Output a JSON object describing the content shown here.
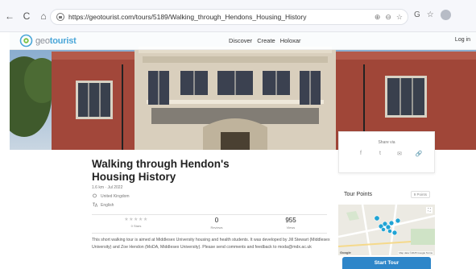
{
  "browser": {
    "url": "https://geotourist.com/tours/5189/Walking_through_Hendons_Housing_History",
    "back": "←",
    "reload": "C",
    "home": "⌂",
    "zoom_icons": [
      "⊕",
      "⊖",
      "☆"
    ],
    "right_icons": [
      "G",
      "☆"
    ]
  },
  "site": {
    "logo_prefix": "geo",
    "logo_suffix": "tourist",
    "nav": [
      "Discover",
      "Create",
      "Holoxar"
    ],
    "login": "Log in"
  },
  "tour": {
    "title": "Walking through Hendon's Housing History",
    "distance_date": "1.6 km · Jul 2022",
    "location": "United Kingdom",
    "language": "English",
    "rating_stars": "★★★★★",
    "rating_label": "0 Stars",
    "reviews_count": "0",
    "reviews_label": "Reviews",
    "views_count": "955",
    "views_label": "Views",
    "description": "This short walking tour is aimed at Middlesex University housing and health students. It was developed by Jill Stewart (Middlesex University) and Zoe Hendon (MoDA, Middlesex University). Please send comments and feedback to moda@mdx.ac.uk"
  },
  "share": {
    "title": "Share via",
    "icons": [
      "f",
      "t",
      "✉",
      "🔗"
    ]
  },
  "tour_points": {
    "title": "Tour Points",
    "badge": "9 Points",
    "button": "Start Tour",
    "google": "Google",
    "credit": "Map data ©2025 Google  Terms"
  },
  "colors": {
    "accent": "#2e86c9",
    "logo": "#4aa6d8",
    "marker": "#21a4d4"
  }
}
